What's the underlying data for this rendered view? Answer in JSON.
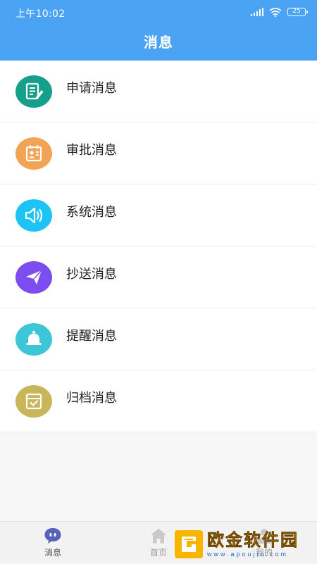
{
  "status_bar": {
    "time": "上午10:02",
    "battery": "25"
  },
  "header": {
    "title": "消息"
  },
  "messages": [
    {
      "label": "申请消息",
      "icon": "document-edit-icon",
      "color": "#16a08b"
    },
    {
      "label": "审批消息",
      "icon": "id-card-icon",
      "color": "#f2a456"
    },
    {
      "label": "系统消息",
      "icon": "speaker-icon",
      "color": "#1ec3f5"
    },
    {
      "label": "抄送消息",
      "icon": "paper-plane-icon",
      "color": "#7c4ef0"
    },
    {
      "label": "提醒消息",
      "icon": "bell-icon",
      "color": "#3cc6d6"
    },
    {
      "label": "归档消息",
      "icon": "archive-box-icon",
      "color": "#c9b55a"
    }
  ],
  "bottom_nav": {
    "items": [
      {
        "label": "消息",
        "active": true
      },
      {
        "label": "首页",
        "active": false
      },
      {
        "label": "我的",
        "active": false
      }
    ],
    "active_color": "#5861b8"
  },
  "watermark": {
    "main": "欧金软件园",
    "url": "www.apoujin.com"
  }
}
